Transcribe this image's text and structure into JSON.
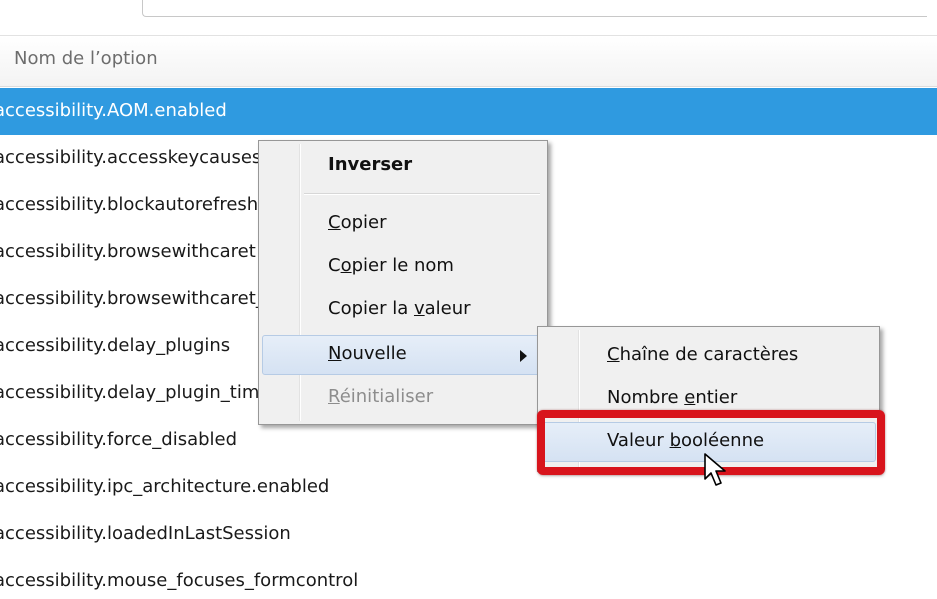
{
  "header": {
    "column_label": "Nom de l’option"
  },
  "rows": [
    {
      "label": "accessibility.AOM.enabled",
      "selected": true
    },
    {
      "label": "accessibility.accesskeycausesactivation"
    },
    {
      "label": "accessibility.blockautorefresh"
    },
    {
      "label": "accessibility.browsewithcaret"
    },
    {
      "label": "accessibility.browsewithcaret_shortcut.enabled"
    },
    {
      "label": "accessibility.delay_plugins"
    },
    {
      "label": "accessibility.delay_plugin_time"
    },
    {
      "label": "accessibility.force_disabled"
    },
    {
      "label": "accessibility.ipc_architecture.enabled"
    },
    {
      "label": "accessibility.loadedInLastSession"
    },
    {
      "label": "accessibility.mouse_focuses_formcontrol"
    }
  ],
  "context_menu": {
    "inverser": "Inverser",
    "copier_mnemonic": "C",
    "copier_rest": "opier",
    "copier_nom_pre": "C",
    "copier_nom_mnemonic": "o",
    "copier_nom_rest": "pier le nom",
    "copier_valeur_pre": "Copier la ",
    "copier_valeur_mnemonic": "v",
    "copier_valeur_rest": "aleur",
    "nouvelle_mnemonic": "N",
    "nouvelle_rest": "ouvelle",
    "reinitialiser_mnemonic": "R",
    "reinitialiser_rest": "éinitialiser"
  },
  "submenu": {
    "chaine_mnemonic": "C",
    "chaine_rest": "haîne de caractères",
    "nombre_pre": "Nombre ",
    "nombre_mnemonic": "e",
    "nombre_rest": "ntier",
    "booleenne_pre": "Valeur ",
    "booleenne_mnemonic": "b",
    "booleenne_rest": "ooléenne"
  },
  "colors": {
    "selection": "#2f9ae0",
    "highlight_border": "#d8141c",
    "menu_background": "#f0f0f0"
  },
  "icons": {
    "submenu_indicator": "chevron-right-icon",
    "mouse_pointer": "cursor-arrow-icon"
  }
}
